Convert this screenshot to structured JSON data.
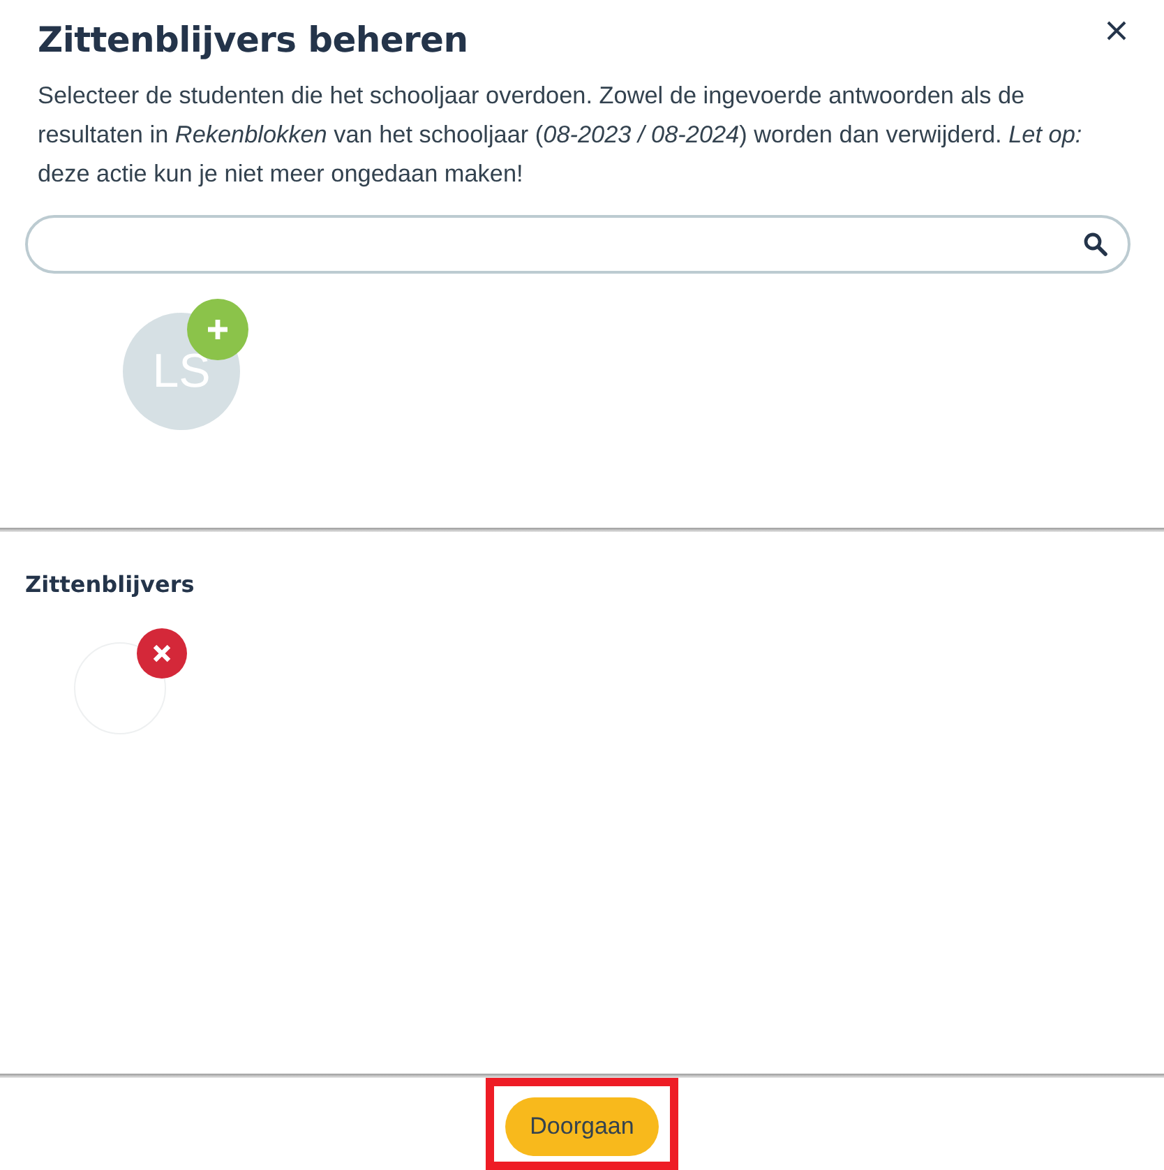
{
  "dialog": {
    "title": "Zittenblijvers beheren",
    "description": "Selecteer de studenten die het schooljaar overdoen. Zowel de ingevoerde antwoorden als de resultaten in *Rekenblokken* van het schooljaar (*08-2023 / 08-2024*) worden dan verwijderd. *Let op:* deze actie kun je niet meer ongedaan maken!"
  },
  "students": [
    {
      "initials": "LS",
      "kind": "add"
    }
  ],
  "retained": {
    "heading": "Zittenblijvers",
    "students": [
      {
        "kind": "remove"
      }
    ]
  },
  "footer": {
    "button": "Doorgaan",
    "highlighted": true
  }
}
